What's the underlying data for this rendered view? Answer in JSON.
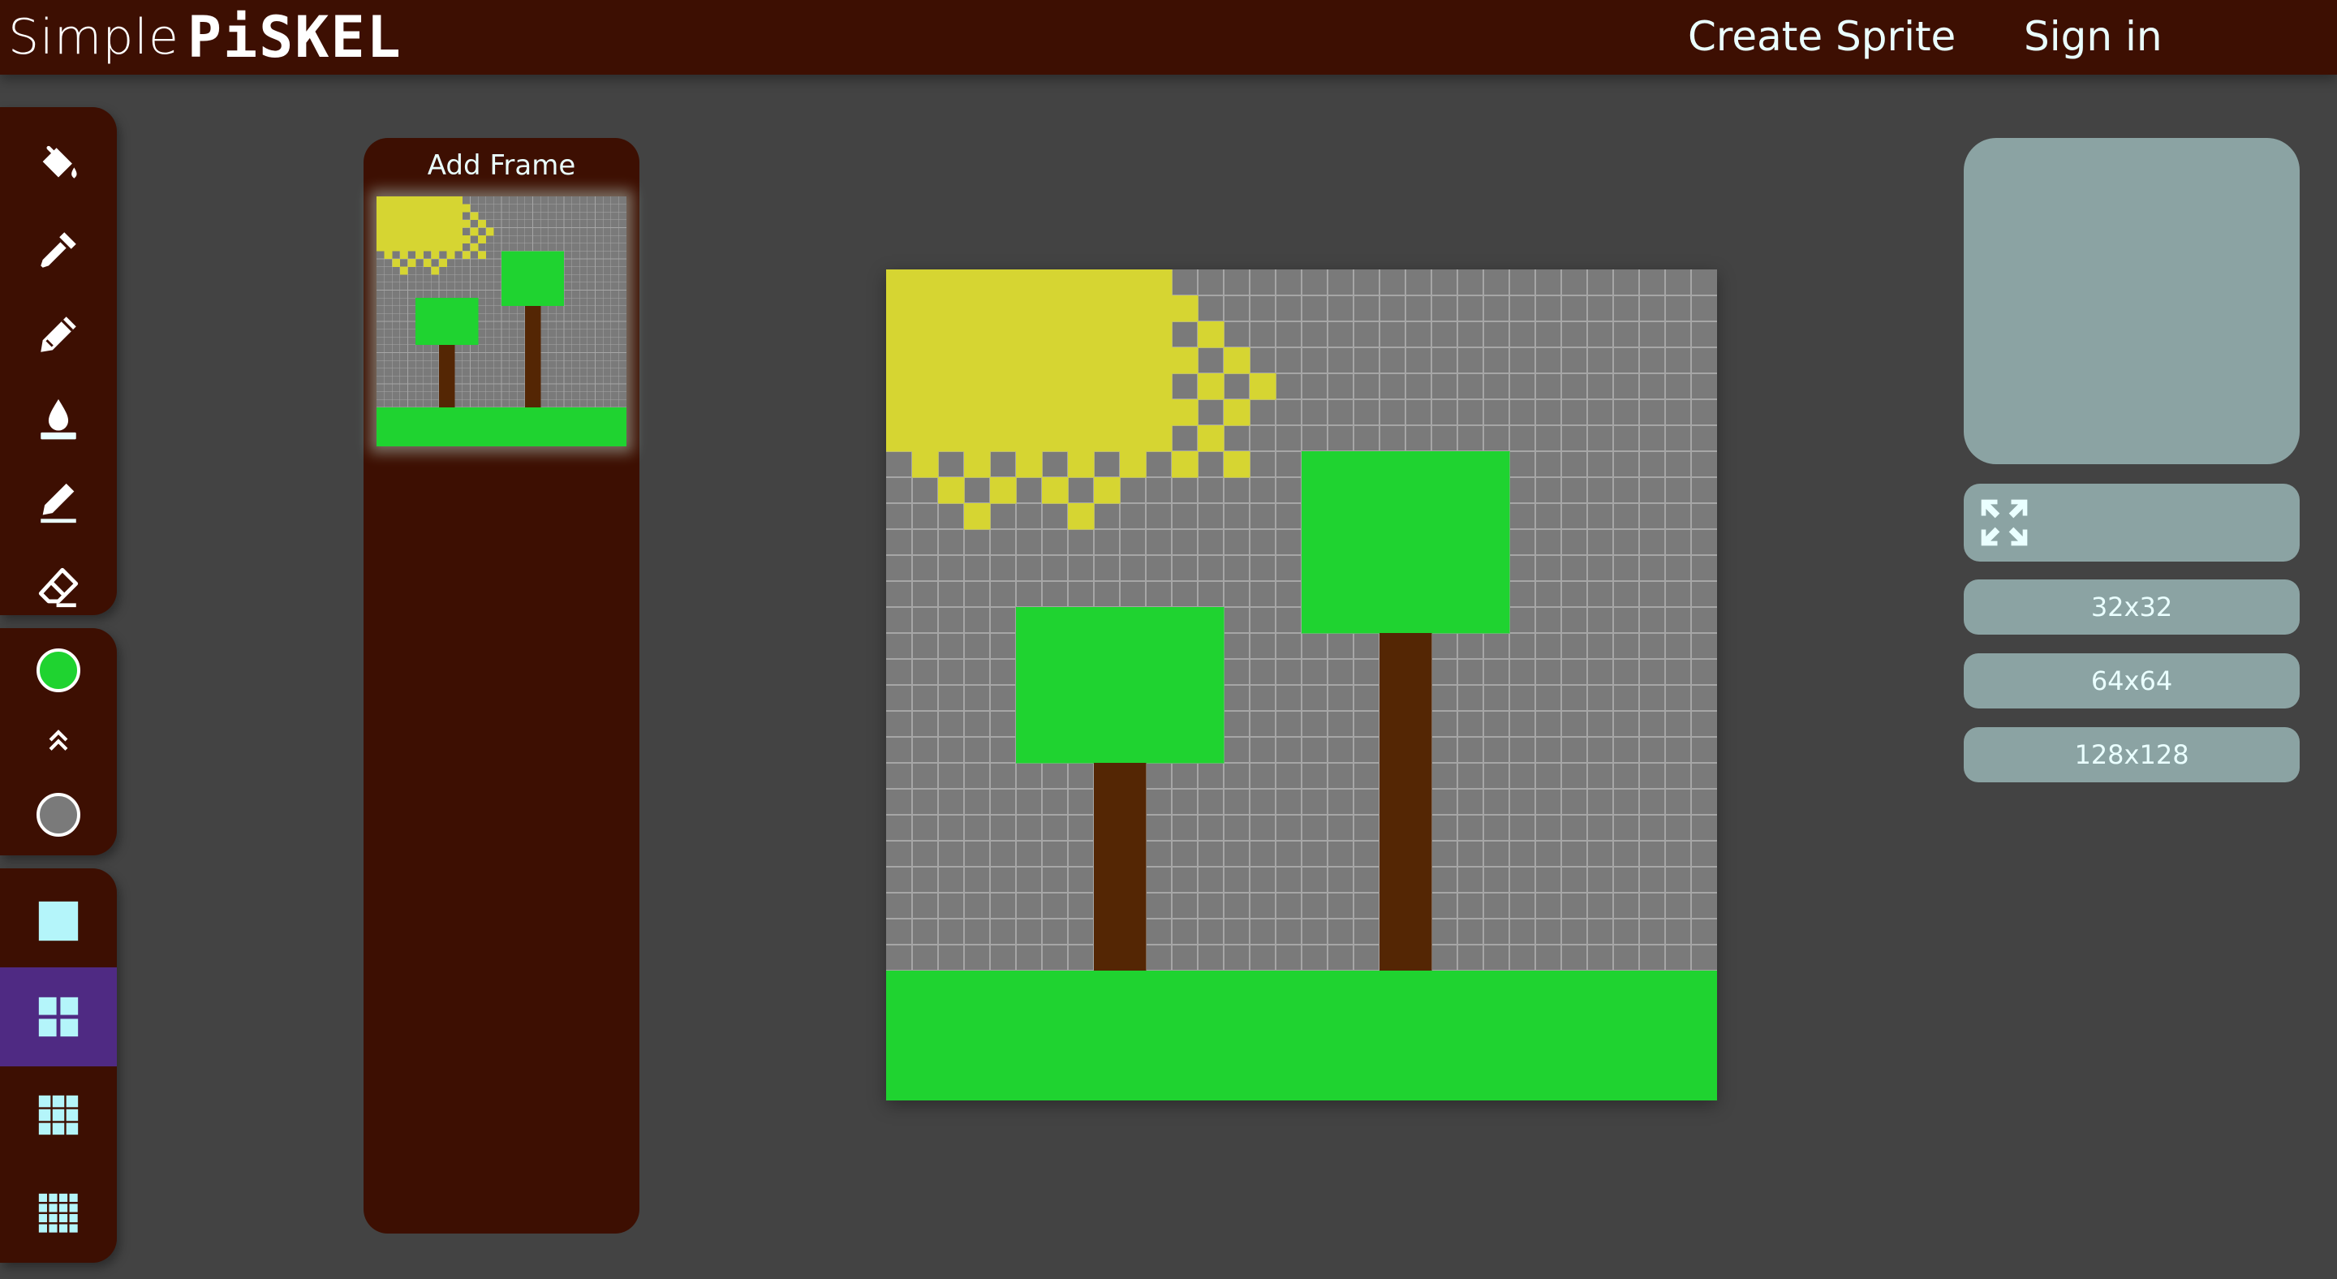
{
  "app": {
    "brand_simple": "Simple",
    "brand_piskel": "PiSKEL"
  },
  "nav": {
    "create_sprite": "Create Sprite",
    "sign_in": "Sign in"
  },
  "tools": {
    "drawing": [
      "paint-bucket-icon",
      "eyedropper-icon",
      "pencil-icon",
      "color-fill-drop-icon",
      "line-pencil-icon",
      "eraser-icon"
    ],
    "colors": {
      "primary": "#1fd330",
      "secondary": "#7a7a7a",
      "swap_icon": "chevron-double-up-icon"
    },
    "brush_sizes": [
      "square-brush-icon",
      "grid-2x2-icon",
      "grid-3x3-icon",
      "grid-4x4-icon"
    ],
    "active_brush_size": 1
  },
  "frames": {
    "add_frame_label": "Add Frame"
  },
  "canvas": {
    "grid_size": 32,
    "colors": {
      "background": "#7a7a7a",
      "grid_line": "#a6a6a6",
      "sun": "#d6d532",
      "leaves": "#1fd330",
      "trunk": "#542604",
      "grass": "#1fd330"
    }
  },
  "sidebar": {
    "size_options": [
      "32x32",
      "64x64",
      "128x128"
    ]
  },
  "theme": {
    "bar": "#3d0f02",
    "background": "#434343",
    "panel": "#8ba3a3",
    "accent_text": "#eaffff",
    "active_tool": "#4f2a83"
  }
}
